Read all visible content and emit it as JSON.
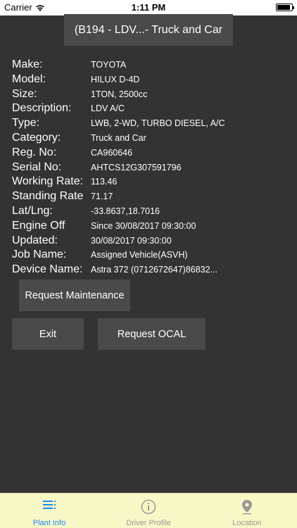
{
  "status_bar": {
    "carrier": "Carrier",
    "time": "1:11 PM"
  },
  "title": "(B194 - LDV...- Truck and Car",
  "details": [
    {
      "label": "Make:",
      "value": "TOYOTA"
    },
    {
      "label": "Model:",
      "value": "HILUX D-4D"
    },
    {
      "label": "Size:",
      "value": "1TON, 2500cc"
    },
    {
      "label": "Description:",
      "value": "LDV A/C"
    },
    {
      "label": "Type:",
      "value": "LWB, 2-WD, TURBO DIESEL, A/C"
    },
    {
      "label": "Category:",
      "value": "Truck and Car"
    },
    {
      "label": "Reg. No:",
      "value": "CA960646"
    },
    {
      "label": "Serial No:",
      "value": "AHTCS12G307591796"
    },
    {
      "label": "Working Rate:",
      "value": "113.46"
    },
    {
      "label": "Standing Rate",
      "value": "71.17"
    },
    {
      "label": "Lat/Lng:",
      "value": "-33.8637,18.7016"
    },
    {
      "label": "Engine Off",
      "value": "Since 30/08/2017 09:30:00"
    },
    {
      "label": "Updated:",
      "value": "30/08/2017 09:30:00"
    },
    {
      "label": "Job Name:",
      "value": "Assigned Vehicle(ASVH)"
    },
    {
      "label": "Device Name:",
      "value": "Astra 372 (0712672647)86832..."
    }
  ],
  "buttons": {
    "request_maintenance": "Request Maintenance",
    "exit": "Exit",
    "request_ocal": "Request OCAL"
  },
  "tabs": [
    {
      "label": "Plant Info",
      "icon": "list-icon",
      "active": true
    },
    {
      "label": "Driver Profile",
      "icon": "info-icon",
      "active": false
    },
    {
      "label": "Location",
      "icon": "location-pin-icon",
      "active": false
    }
  ],
  "colors": {
    "background": "#333333",
    "button": "#4a4a4a",
    "tab_bar": "#f8f7c6",
    "active_tab": "#1a8cff",
    "inactive_tab": "#9a9a9a"
  }
}
